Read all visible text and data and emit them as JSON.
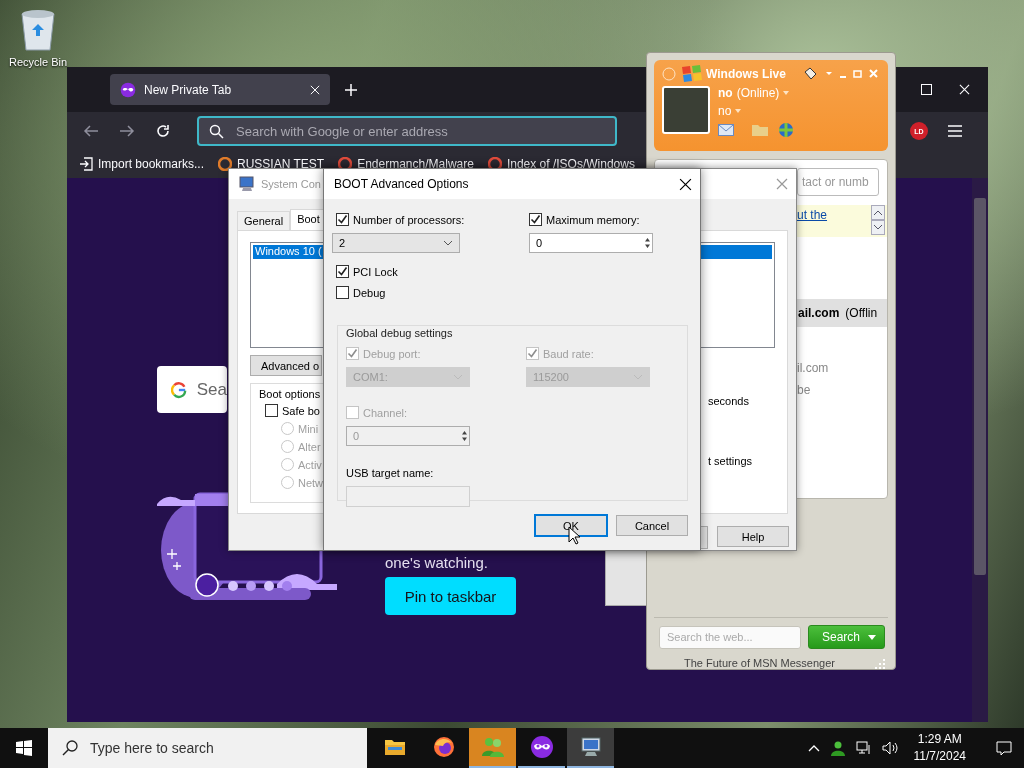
{
  "desktop": {
    "icons": [
      {
        "label": "Recycle Bin"
      }
    ]
  },
  "browser": {
    "tabs": [
      {
        "label": "New Private Tab",
        "selected": true
      }
    ],
    "address": {
      "placeholder": "Search with Google or enter address"
    },
    "account_badge": "LD",
    "bookmarks": [
      {
        "kind": "import",
        "label": "Import bookmarks..."
      },
      {
        "kind": "site",
        "label": "RUSSIAN TEST"
      },
      {
        "kind": "site",
        "label": "Endermanch/Malware"
      },
      {
        "kind": "site",
        "label": "Index of /ISOs/Windows"
      }
    ],
    "page": {
      "search_placeholder": "Sea",
      "tagline": "one's watching.",
      "button": "Pin to taskbar"
    }
  },
  "system_config": {
    "title": "System Con",
    "tabs": [
      {
        "label": "General",
        "selected": false
      },
      {
        "label": "Boot",
        "selected": true
      }
    ],
    "boot_entries": [
      {
        "label": "Windows 10 (",
        "selected": true
      }
    ],
    "advanced_button": "Advanced o",
    "boot_options": {
      "title": "Boot options",
      "safe_boot": {
        "label": "Safe bo",
        "checked": false
      },
      "modes": [
        {
          "label": "Mini",
          "selected": false
        },
        {
          "label": "Alter",
          "selected": false
        },
        {
          "label": "Activ",
          "selected": false
        },
        {
          "label": "Netw",
          "selected": false
        }
      ]
    },
    "timeout_unit": "seconds",
    "permanent_label": "t settings",
    "buttons": [
      {
        "label": "Help"
      }
    ]
  },
  "boot_dialog": {
    "title": "BOOT Advanced Options",
    "processors": {
      "label": "Number of processors:",
      "checked": true,
      "value": "2"
    },
    "memory": {
      "label": "Maximum memory:",
      "checked": true,
      "value": "0"
    },
    "options": [
      {
        "label": "PCI Lock",
        "checked": true
      },
      {
        "label": "Debug",
        "checked": false
      }
    ],
    "debug_settings": {
      "title": "Global debug settings",
      "disabled": true,
      "debug_port": {
        "label": "Debug port:",
        "checked": true,
        "value": "COM1:"
      },
      "baud_rate": {
        "label": "Baud rate:",
        "checked": true,
        "value": "115200"
      },
      "channel": {
        "label": "Channel:",
        "checked": false,
        "value": "0"
      },
      "usb_target": {
        "label": "USB target name:"
      }
    },
    "buttons": [
      {
        "label": "OK",
        "default": true
      },
      {
        "label": "Cancel",
        "default": false
      }
    ]
  },
  "messenger": {
    "title": "Windows Live",
    "name": "no",
    "status": "(Online)",
    "personal_message": "no",
    "contact_search": "tact or numb",
    "notice_link": "ut the",
    "group_header": {
      "name": "ail.com",
      "status": "(Offlin"
    },
    "contacts": [
      {
        "label": "il.com"
      },
      {
        "label": "be"
      }
    ],
    "web_search": {
      "placeholder": "Search the web...",
      "button": "Search"
    },
    "footer": "The Future of MSN Messenger"
  },
  "taskbar": {
    "search_placeholder": "Type here to search",
    "apps": [
      {
        "kind": "explorer",
        "selected": false,
        "running": false,
        "flashing": false
      },
      {
        "kind": "firefox",
        "selected": false,
        "running": false,
        "flashing": false
      },
      {
        "kind": "messenger",
        "selected": false,
        "running": true,
        "flashing": true
      },
      {
        "kind": "private",
        "selected": false,
        "running": true,
        "flashing": false
      },
      {
        "kind": "sysconfig",
        "selected": true,
        "running": true,
        "flashing": false
      }
    ],
    "time": "1:29 AM",
    "date": "11/7/2024"
  }
}
